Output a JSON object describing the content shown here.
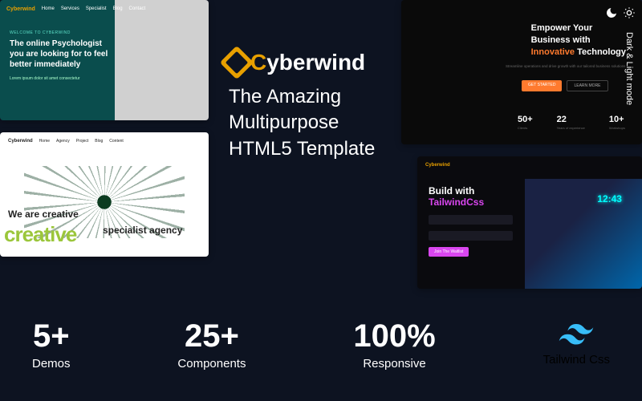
{
  "brand": {
    "name": "Cyberwind",
    "prefix": "C",
    "suffix": "yberwind"
  },
  "tagline": {
    "l1": "The Amazing",
    "l2": "Multipurpose",
    "l3": "HTML5 Template"
  },
  "stats": [
    {
      "num": "5+",
      "label": "Demos"
    },
    {
      "num": "25+",
      "label": "Components"
    },
    {
      "num": "100%",
      "label": "Responsive"
    }
  ],
  "tailwind": "Tailwind Css",
  "darklight": "Dark & Light mode",
  "demo1": {
    "brand": "Cyberwind",
    "nav": [
      "Home",
      "Services",
      "Specialist",
      "Blog",
      "Contact"
    ],
    "welcome": "WELCOME TO CYBERWIND",
    "headline": "The online Psychologist you are looking for to feel better immediately",
    "sub": "Lorem ipsum dolor sit amet consectetur"
  },
  "demo2": {
    "headline_l1": "Empower Your",
    "headline_l2": "Business with",
    "headline_l3a": "Innovative",
    "headline_l3b": " Technology",
    "sub": "Streamline operations and drive growth with our tailored business solutions",
    "btn1": "GET STARTED",
    "btn2": "LEARN MORE",
    "stat1": "50+",
    "stat1l": "Clients",
    "stat2": "22",
    "stat2l": "Years of experience",
    "stat3": "10+",
    "stat3l": "Workshops"
  },
  "demo3": {
    "brand": "Cyberwind",
    "nav": [
      "Home",
      "Agency",
      "Project",
      "Blog",
      "Content"
    ],
    "l1": "We are creative",
    "l2": "creative",
    "l3": "specialist agency"
  },
  "demo4": {
    "brand": "Cyberwind",
    "title_l1": "Build with",
    "title_l2": "TailwindCss",
    "cta": "Join The Waitlist",
    "clock": "12:43"
  }
}
